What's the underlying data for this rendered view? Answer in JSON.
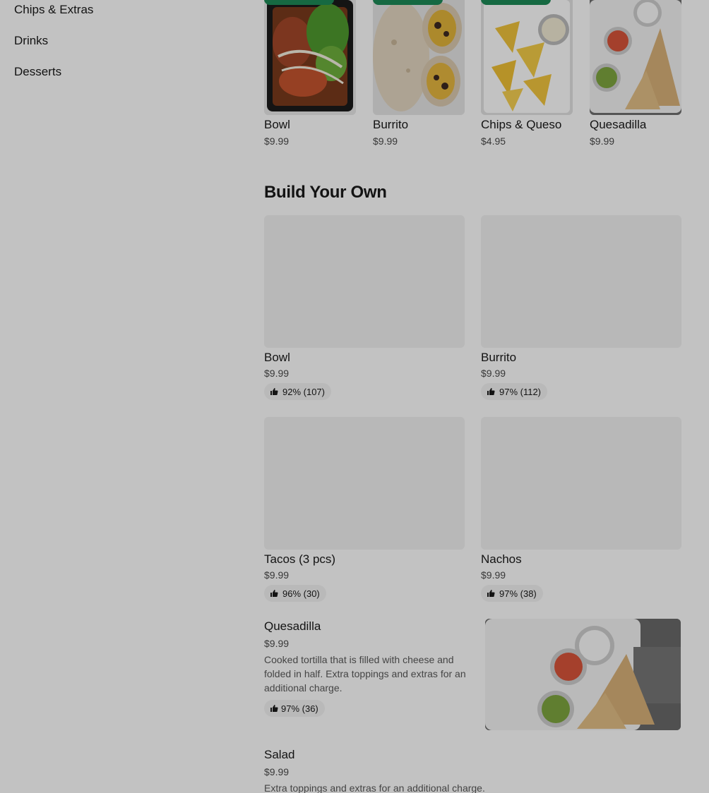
{
  "sidebar": {
    "items": [
      {
        "label": "Chips & Extras"
      },
      {
        "label": "Drinks"
      },
      {
        "label": "Desserts"
      }
    ]
  },
  "featured": [
    {
      "name": "Bowl",
      "price": "$9.99"
    },
    {
      "name": "Burrito",
      "price": "$9.99"
    },
    {
      "name": "Chips & Queso",
      "price": "$4.95"
    },
    {
      "name": "Quesadilla",
      "price": "$9.99"
    }
  ],
  "build_your_own": {
    "title": "Build Your Own",
    "items": [
      {
        "name": "Bowl",
        "price": "$9.99",
        "rating": "92% (107)"
      },
      {
        "name": "Burrito",
        "price": "$9.99",
        "rating": "97% (112)"
      },
      {
        "name": "Tacos (3 pcs)",
        "price": "$9.99",
        "rating": "96% (30)"
      },
      {
        "name": "Nachos",
        "price": "$9.99",
        "rating": "97% (38)"
      }
    ]
  },
  "list": [
    {
      "name": "Quesadilla",
      "price": "$9.99",
      "description": "Cooked tortilla that is filled with cheese and folded in half. Extra toppings and extras for an additional charge.",
      "rating": "97% (36)"
    },
    {
      "name": "Salad",
      "price": "$9.99",
      "description": "Extra toppings and extras for an additional charge."
    }
  ],
  "colors": {
    "accent_green": "#1d8a57",
    "overlay": "rgba(0,0,0,0.24)"
  },
  "icons": {
    "rating": "thumbs-up-icon"
  }
}
